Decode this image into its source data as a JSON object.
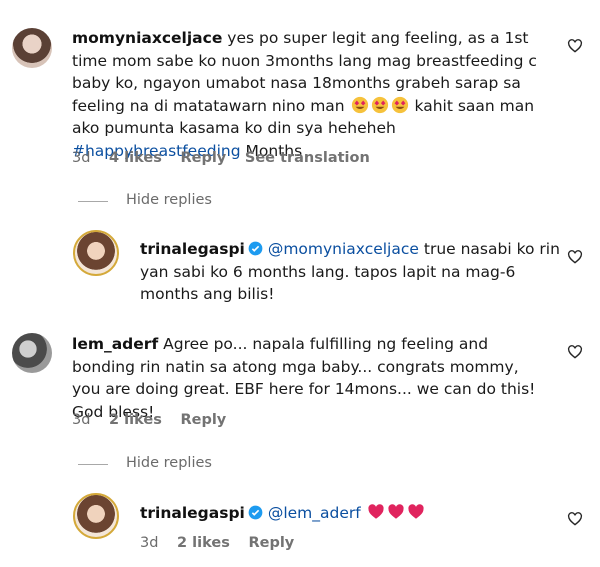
{
  "comments": [
    {
      "username": "momyniaxceljace",
      "text": "yes po super legit ang feeling, as a 1st time mom sabe ko nuon 3months lang mag breastfeeding c baby ko, ngayon umabot nasa 18months grabeh sarap sa feeling na di matatawarn nino man",
      "text_after_emoji": "kahit saan man ako pumunta kasama ko din sya heheheh",
      "hashtag": "#happybreastfeeding",
      "text_end": "Months",
      "time": "3d",
      "likes": "4 likes",
      "reply": "Reply",
      "translate": "See translation"
    },
    {
      "username": "lem_aderf",
      "text": "Agree po... napala fulfilling ng feeling and bonding rin natin sa atong mga baby... congrats mommy, you are doing great. EBF here for 14mons... we can do this! God bless!",
      "time": "3d",
      "likes": "2 likes",
      "reply": "Reply"
    }
  ],
  "replies": [
    {
      "username": "trinalegaspi",
      "mention": "@momyniaxceljace",
      "text": "true nasabi ko rin yan sabi ko 6 months lang. tapos lapit na mag-6 months ang bilis!"
    },
    {
      "username": "trinalegaspi",
      "mention": "@lem_aderf",
      "time": "3d",
      "likes": "2 likes",
      "reply": "Reply"
    }
  ],
  "hide_replies_label": "Hide replies",
  "icons": {
    "like": "heart-outline-icon",
    "verified": "verified-badge-icon",
    "emoji": "heart-eyes-emoji",
    "red_heart": "red-heart-emoji"
  },
  "colors": {
    "mention": "#0b4fa0",
    "verified": "#1d9bf0",
    "red_heart": "#e0245e"
  }
}
